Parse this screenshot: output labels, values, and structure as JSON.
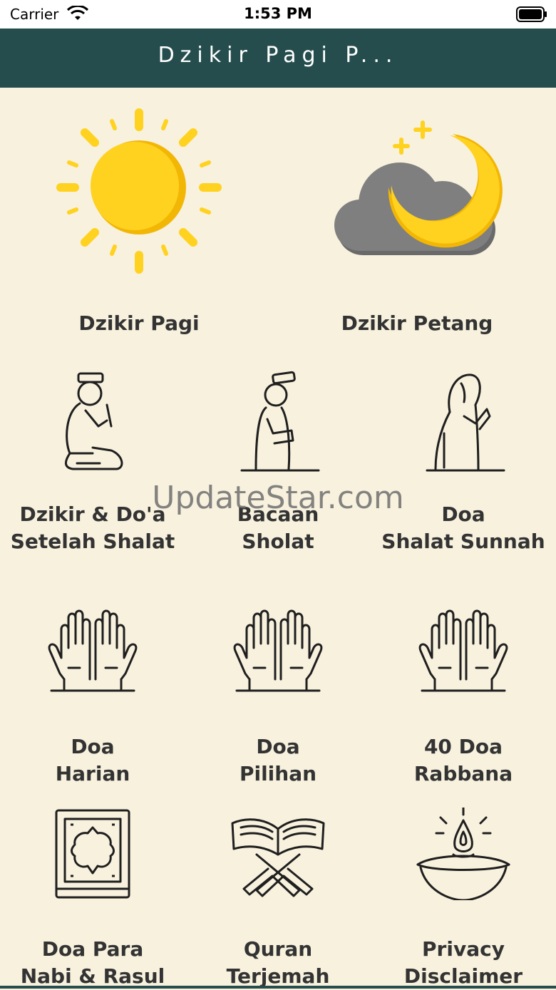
{
  "status": {
    "carrier": "Carrier",
    "time": "1:53 PM"
  },
  "nav": {
    "title": "Dzikir Pagi P..."
  },
  "watermark": "UpdateStar.com",
  "tiles": [
    {
      "label": "Dzikir Pagi",
      "icon": "sun-icon"
    },
    {
      "label": "Dzikir Petang",
      "icon": "moon-cloud-icon"
    },
    {
      "label": "Dzikir & Do'a\nSetelah Shalat",
      "icon": "sitting-man-praying-icon"
    },
    {
      "label": "Bacaan\nSholat",
      "icon": "standing-man-praying-icon"
    },
    {
      "label": "Doa\nShalat Sunnah",
      "icon": "woman-praying-icon"
    },
    {
      "label": "Doa\nHarian",
      "icon": "praying-hands-icon"
    },
    {
      "label": "Doa\nPilihan",
      "icon": "praying-hands-icon"
    },
    {
      "label": "40 Doa\nRabbana",
      "icon": "praying-hands-icon"
    },
    {
      "label": "Doa Para\nNabi & Rasul",
      "icon": "book-icon"
    },
    {
      "label": "Quran\nTerjemah",
      "icon": "quran-stand-icon"
    },
    {
      "label": "Privacy\nDisclaimer",
      "icon": "oil-lamp-icon"
    }
  ],
  "colors": {
    "header": "#264d4d",
    "background": "#f7f1de",
    "sun": "#ffd21f",
    "cloud": "#7b7b7b"
  }
}
